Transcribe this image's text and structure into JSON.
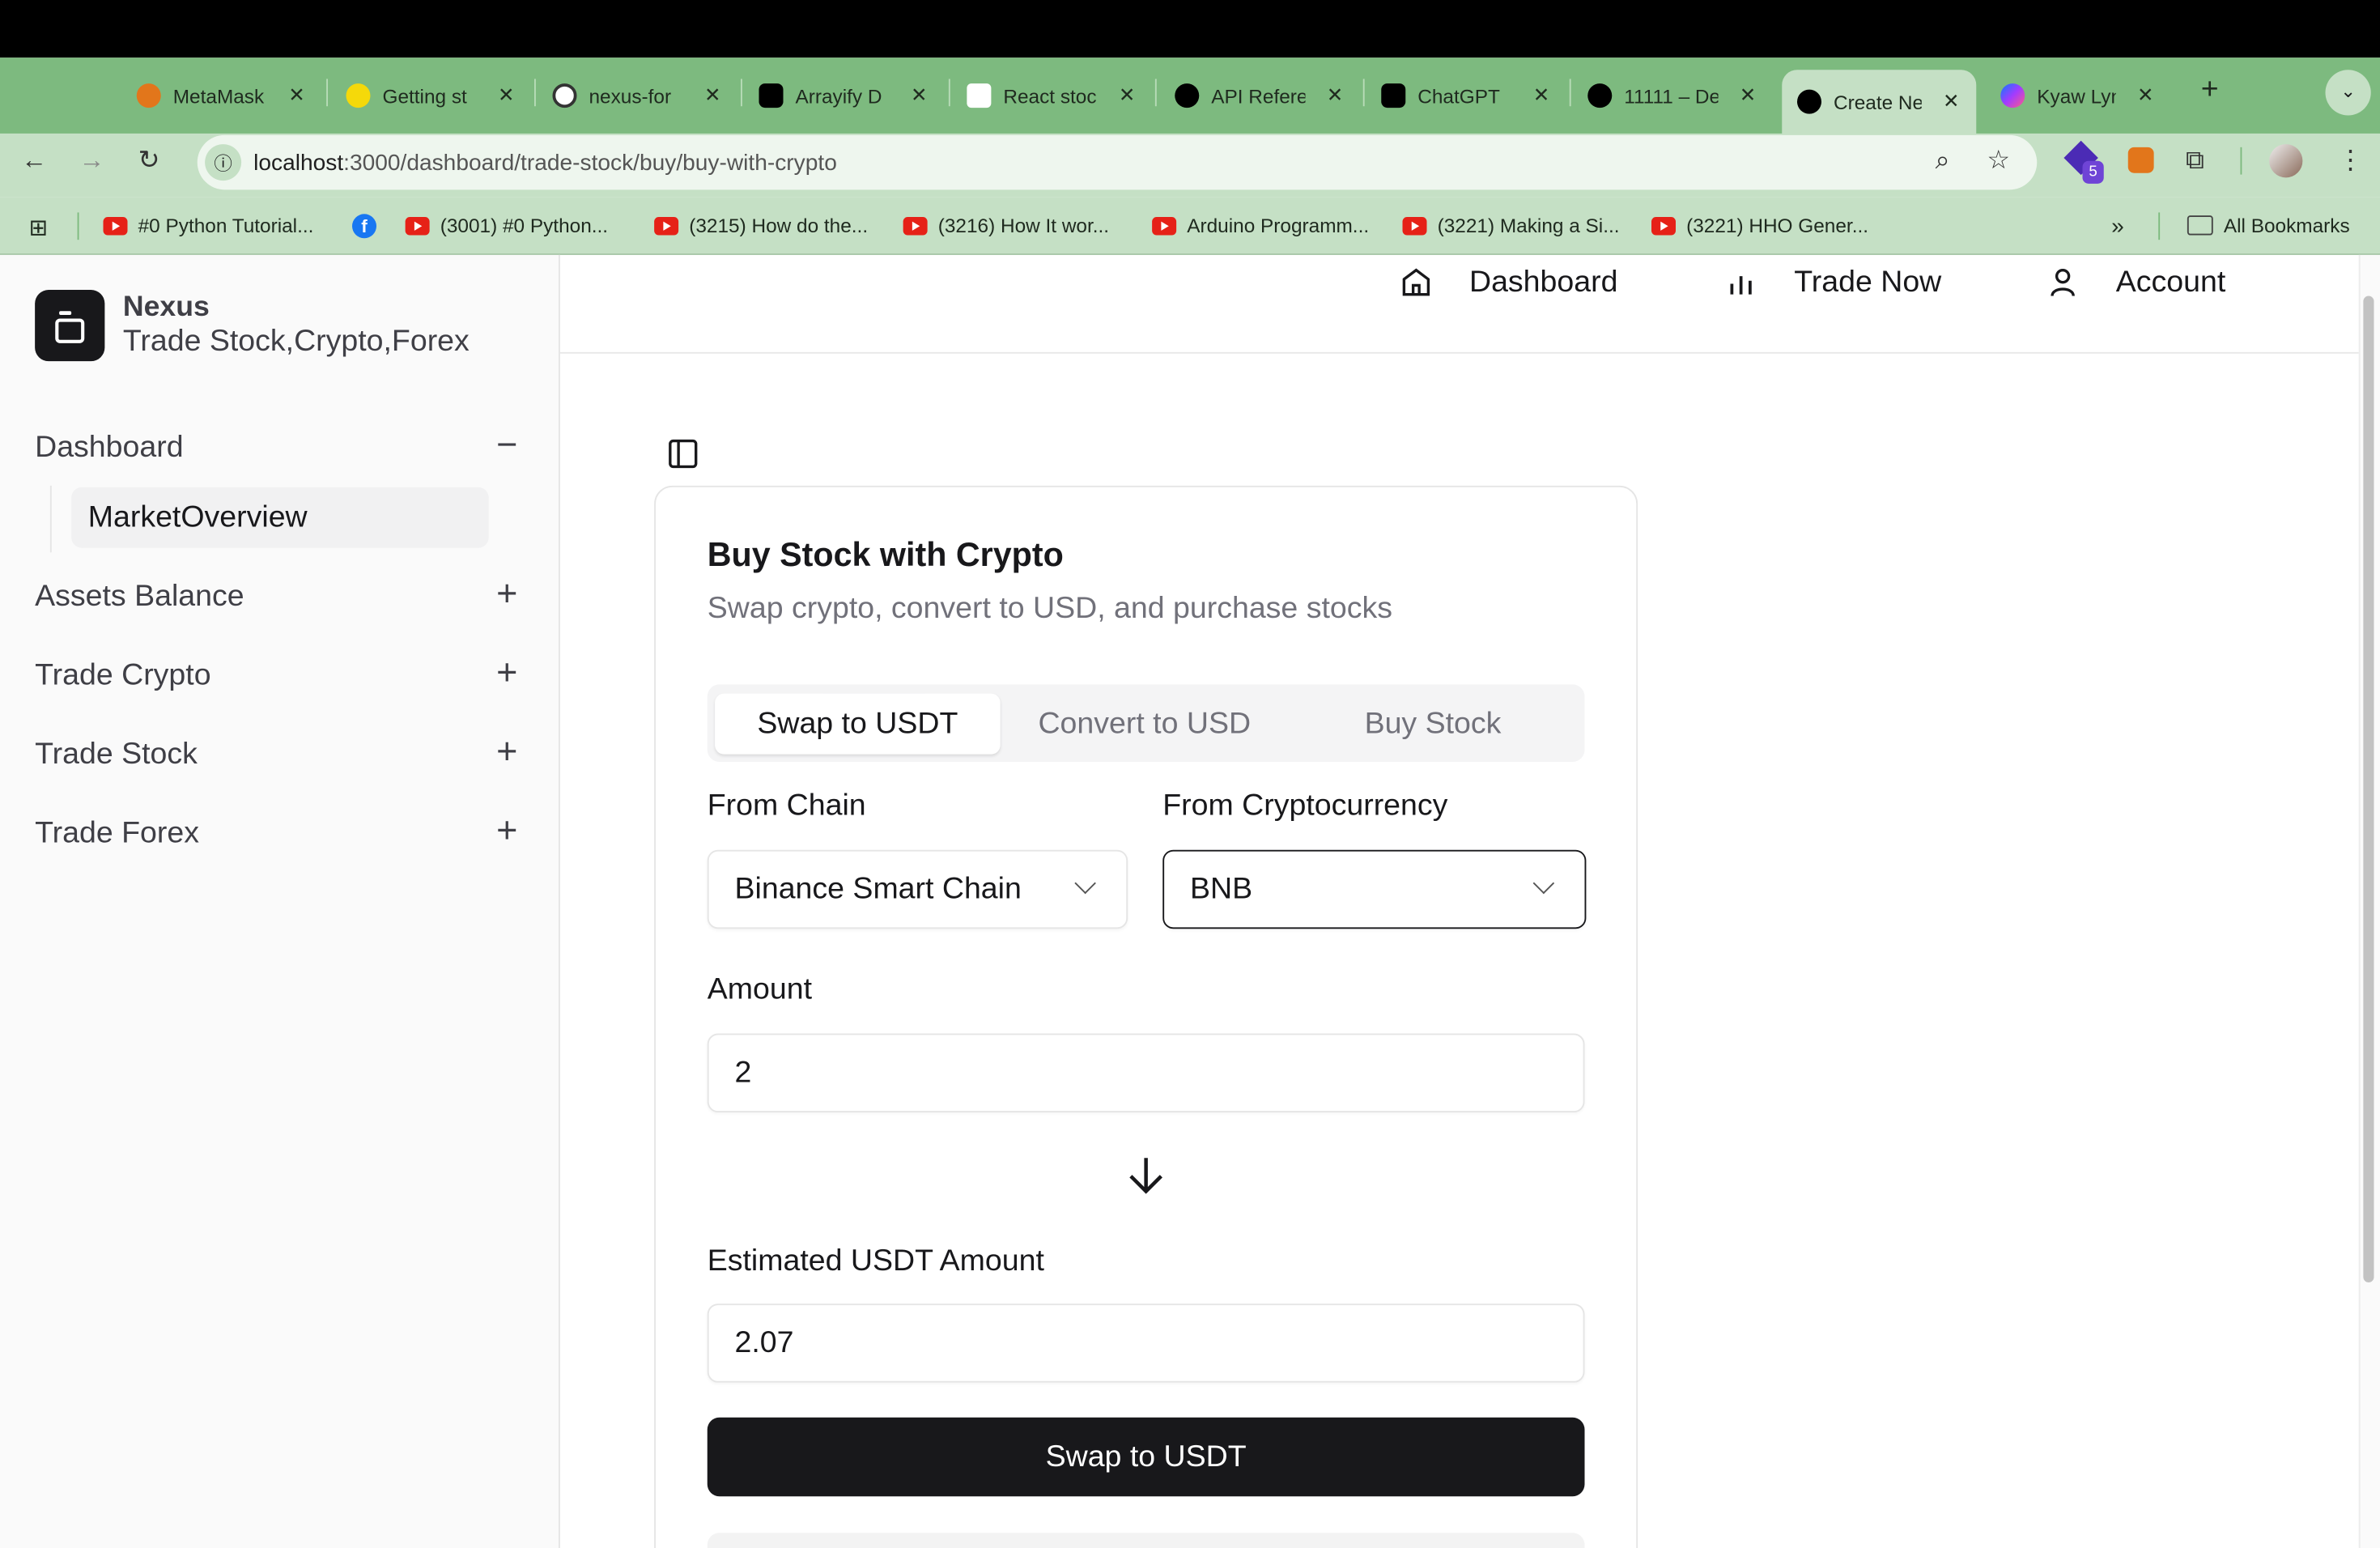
{
  "browser": {
    "tabs": [
      {
        "title": "MetaMask",
        "icon": "metamask-icon",
        "color": "#e2761b"
      },
      {
        "title": "Getting st",
        "icon": "warning-icon",
        "color": "#f5d90a"
      },
      {
        "title": "nexus-for",
        "icon": "github-icon",
        "color": "#ffffff"
      },
      {
        "title": "Arrayify D",
        "icon": "openai-icon",
        "color": "#000000"
      },
      {
        "title": "React stoc",
        "icon": "v0-icon",
        "color": "#ffffff"
      },
      {
        "title": "API Refere",
        "icon": "nextjs-icon",
        "color": "#000000"
      },
      {
        "title": "ChatGPT",
        "icon": "openai-icon",
        "color": "#000000"
      },
      {
        "title": "11111 – De",
        "icon": "vercel-icon",
        "color": "#000000"
      },
      {
        "title": "Create Ne",
        "icon": "vercel-icon",
        "color": "#000000",
        "active": true
      },
      {
        "title": "Kyaw Lyn",
        "icon": "messenger-icon",
        "color": "#a33bff"
      }
    ],
    "url_host": "localhost",
    "url_path": ":3000/dashboard/trade-stock/buy/buy-with-crypto",
    "extension_badge": "5",
    "bookmarks": [
      {
        "label": "#0 Python Tutorial...",
        "icon": "youtube-icon"
      },
      {
        "label": "",
        "icon": "facebook-icon"
      },
      {
        "label": "(3001) #0 Python...",
        "icon": "youtube-icon"
      },
      {
        "label": "(3215) How do the...",
        "icon": "youtube-icon"
      },
      {
        "label": "(3216) How It wor...",
        "icon": "youtube-icon"
      },
      {
        "label": "Arduino Programm...",
        "icon": "youtube-icon"
      },
      {
        "label": "(3221) Making a Si...",
        "icon": "youtube-icon"
      },
      {
        "label": "(3221) HHO Gener...",
        "icon": "youtube-icon"
      }
    ],
    "more_bookmarks": "»",
    "all_bookmarks": "All Bookmarks"
  },
  "sidebar": {
    "brand": "Nexus",
    "tagline": "Trade Stock,Crypto,Forex",
    "items": [
      {
        "label": "Dashboard",
        "sign": "−"
      },
      {
        "label": "Assets Balance",
        "sign": "+"
      },
      {
        "label": "Trade Crypto",
        "sign": "+"
      },
      {
        "label": "Trade Stock",
        "sign": "+"
      },
      {
        "label": "Trade Forex",
        "sign": "+"
      }
    ],
    "subitem": "MarketOverview"
  },
  "topnav": {
    "dashboard": "Dashboard",
    "trade_now": "Trade Now",
    "account": "Account"
  },
  "card": {
    "title": "Buy Stock with Crypto",
    "subtitle": "Swap crypto, convert to USD, and purchase stocks",
    "tabs": [
      "Swap to USDT",
      "Convert to USD",
      "Buy Stock"
    ],
    "from_chain_label": "From Chain",
    "from_chain_value": "Binance Smart Chain",
    "from_crypto_label": "From Cryptocurrency",
    "from_crypto_value": "BNB",
    "amount_label": "Amount",
    "amount_value": "2",
    "estimate_label": "Estimated USDT Amount",
    "estimate_value": "2.07",
    "submit": "Swap to USDT"
  }
}
